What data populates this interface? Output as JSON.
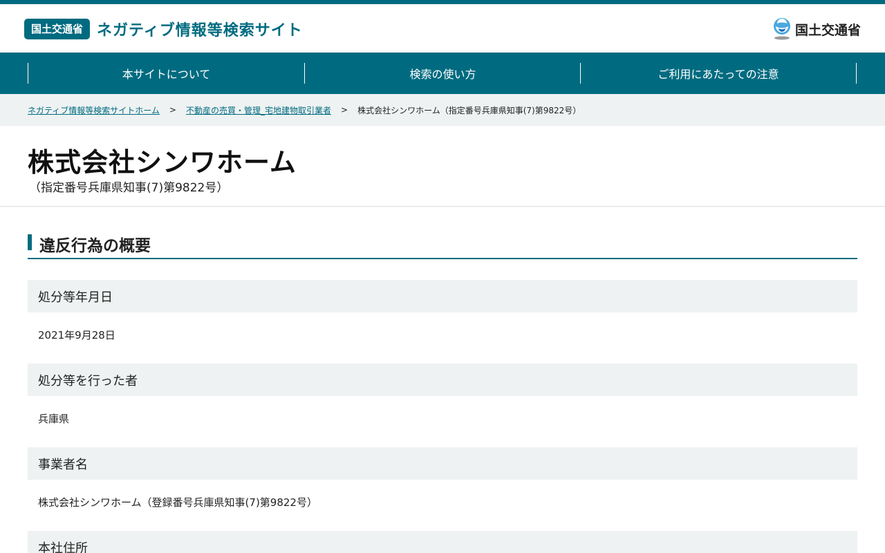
{
  "header": {
    "badge": "国土交通省",
    "site_title": "ネガティブ情報等検索サイト",
    "ministry_name": "国土交通省",
    "logo_icon": "mlit-logo-icon"
  },
  "nav": {
    "items": [
      {
        "label": "本サイトについて"
      },
      {
        "label": "検索の使い方"
      },
      {
        "label": "ご利用にあたっての注意"
      }
    ]
  },
  "breadcrumb": {
    "home": "ネガティブ情報等検索サイトホーム",
    "separator": ">",
    "category": "不動産の売買・管理_宅地建物取引業者",
    "current": "株式会社シンワホーム（指定番号兵庫県知事(7)第9822号）"
  },
  "page": {
    "title": "株式会社シンワホーム",
    "subtitle": "（指定番号兵庫県知事(7)第9822号）"
  },
  "section": {
    "title": "違反行為の概要"
  },
  "fields": [
    {
      "label": "処分等年月日",
      "value": "2021年9月28日"
    },
    {
      "label": "処分等を行った者",
      "value": "兵庫県"
    },
    {
      "label": "事業者名",
      "value": "株式会社シンワホーム（登録番号兵庫県知事(7)第9822号）"
    },
    {
      "label": "本社住所"
    }
  ],
  "colors": {
    "accent": "#006b80",
    "label_background": "#eef2f2"
  }
}
